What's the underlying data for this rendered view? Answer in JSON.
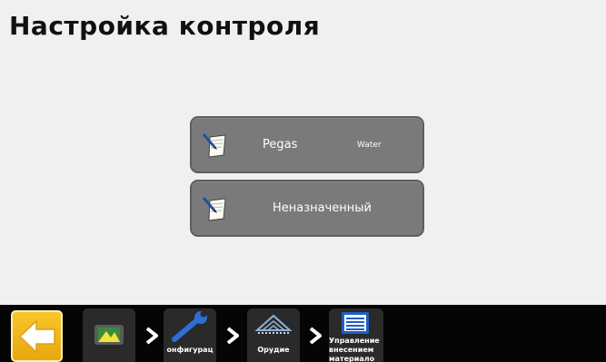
{
  "page": {
    "title": "Настройка контроля"
  },
  "controls": [
    {
      "name": "Pegas",
      "sub": "Water",
      "icon": "document-pen-icon"
    },
    {
      "name": "Неназначенный",
      "sub": "",
      "icon": "document-pen-icon"
    }
  ],
  "bottom_nav": {
    "back_icon": "back-arrow-icon",
    "crumbs": [
      {
        "label": "",
        "icon": "display-console-icon"
      },
      {
        "label": "онфигурац",
        "icon": "wrench-icon"
      },
      {
        "label": "Орудие",
        "icon": "implement-boom-icon"
      },
      {
        "label": "Управление внесением материало",
        "icon": "list-icon"
      }
    ]
  },
  "colors": {
    "button": "#7a7a7a",
    "bar": "#050505",
    "back": "#f5b81c"
  }
}
